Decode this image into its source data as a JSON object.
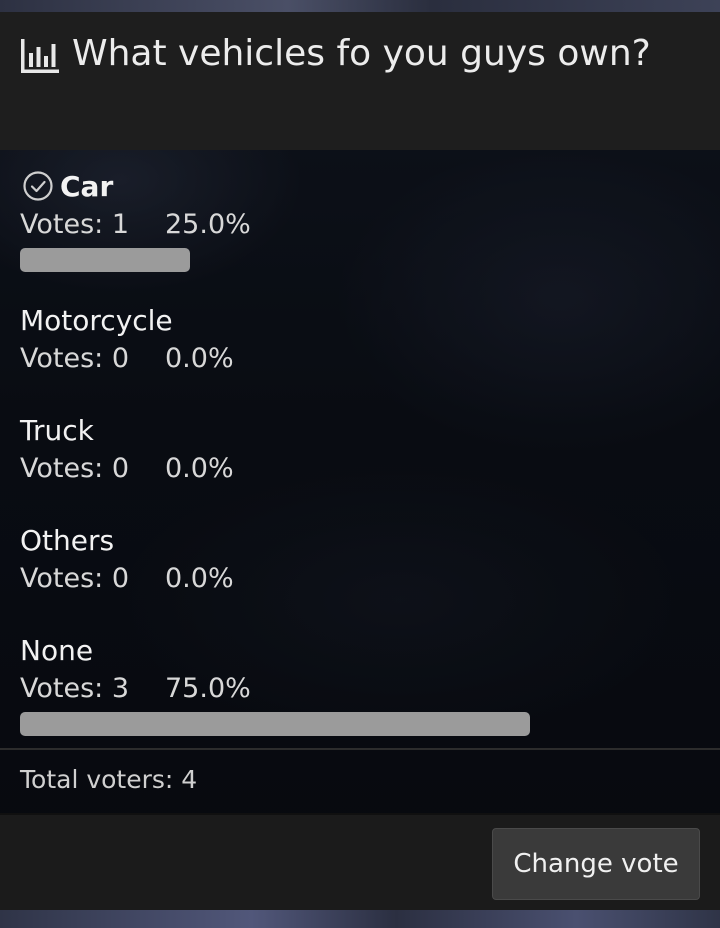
{
  "poll": {
    "title": "What vehicles fo you guys own?",
    "title_icon": "bar-chart-icon",
    "options": [
      {
        "label": "Car",
        "votes_text": "Votes: 1",
        "percent_text": "25.0%",
        "percent": 25.0,
        "selected": true
      },
      {
        "label": "Motorcycle",
        "votes_text": "Votes: 0",
        "percent_text": "0.0%",
        "percent": 0.0,
        "selected": false
      },
      {
        "label": "Truck",
        "votes_text": "Votes: 0",
        "percent_text": "0.0%",
        "percent": 0.0,
        "selected": false
      },
      {
        "label": "Others",
        "votes_text": "Votes: 0",
        "percent_text": "0.0%",
        "percent": 0.0,
        "selected": false
      },
      {
        "label": "None",
        "votes_text": "Votes: 3",
        "percent_text": "75.0%",
        "percent": 75.0,
        "selected": false
      }
    ],
    "total_voters_text": "Total voters: 4",
    "change_vote_label": "Change vote",
    "selected_icon": "check-circle-icon"
  },
  "colors": {
    "header_bg": "#1e1e1e",
    "bar_fill": "#9b9b9b",
    "button_bg": "#3a3a3a"
  }
}
